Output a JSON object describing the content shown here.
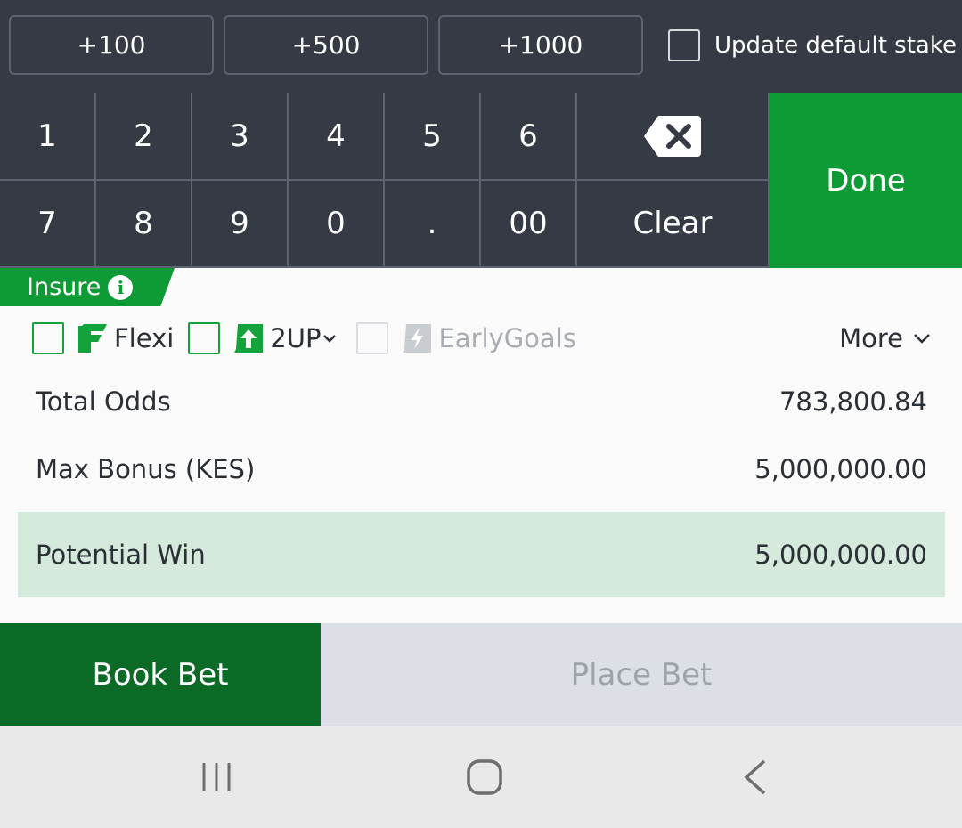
{
  "quick_stake": {
    "buttons": [
      "+100",
      "+500",
      "+1000"
    ],
    "update_default_label": "Update default stake"
  },
  "keypad": {
    "row1": [
      "1",
      "2",
      "3",
      "4",
      "5",
      "6"
    ],
    "row2": [
      "7",
      "8",
      "9",
      "0",
      ".",
      "00"
    ],
    "clear_label": "Clear",
    "done_label": "Done",
    "backspace_icon": "backspace-icon"
  },
  "insure": {
    "label": "Insure",
    "info_glyph": "i"
  },
  "options": {
    "flexi_label": "Flexi",
    "twoup_label": "2UP",
    "earlygoals_label": "EarlyGoals",
    "more_label": "More"
  },
  "summary": {
    "total_odds_label": "Total Odds",
    "total_odds_value": "783,800.84",
    "max_bonus_label": "Max Bonus (KES)",
    "max_bonus_value": "5,000,000.00",
    "potential_win_label": "Potential Win",
    "potential_win_value": "5,000,000.00"
  },
  "actions": {
    "book_bet_label": "Book Bet",
    "place_bet_label": "Place Bet"
  },
  "colors": {
    "dark_bg": "#353a45",
    "green": "#0e9a35",
    "dark_green": "#0b6b26",
    "win_bg": "#d5eadc"
  }
}
